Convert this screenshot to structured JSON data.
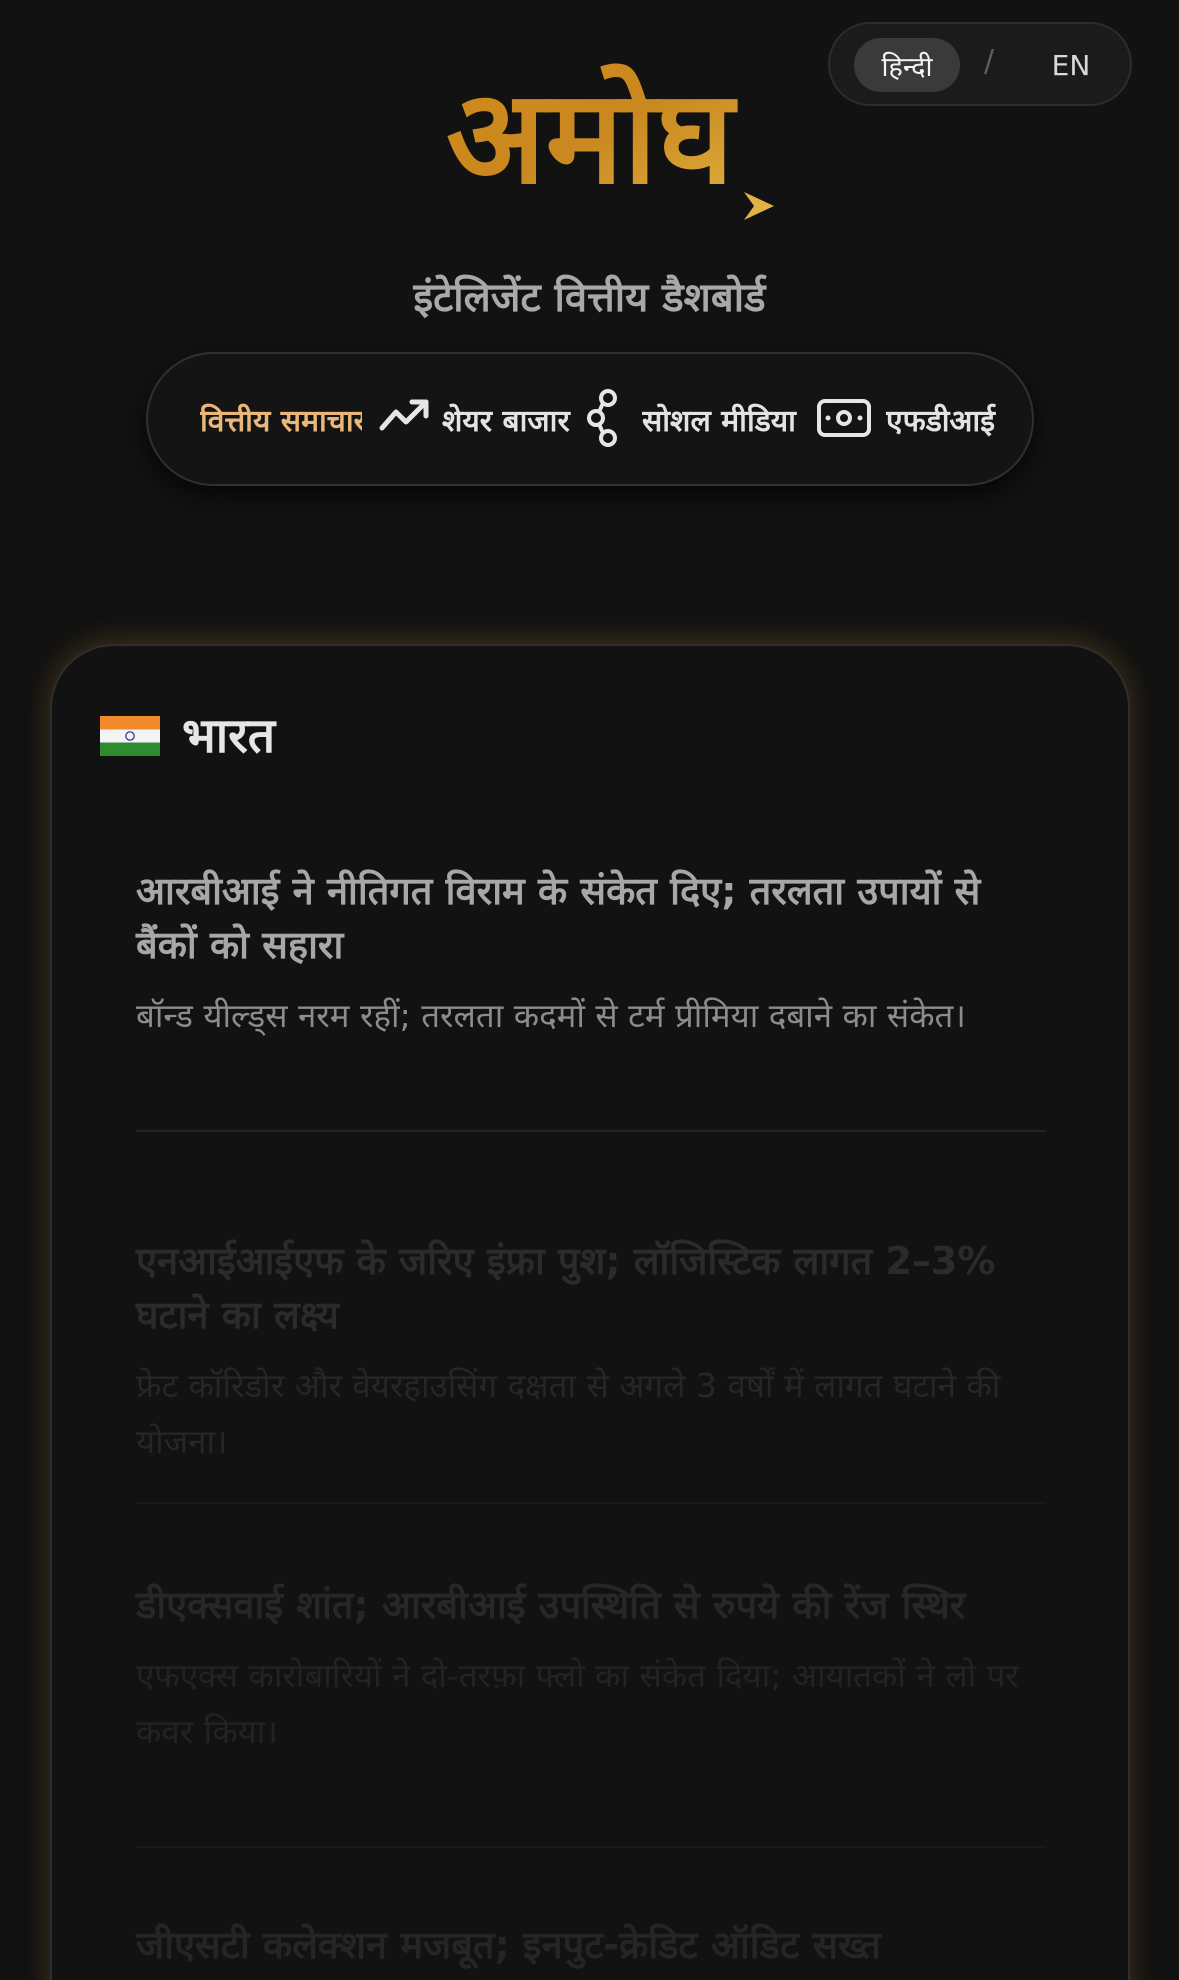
{
  "language_toggle": {
    "active": "हिन्दी",
    "separator": "/",
    "inactive": "EN"
  },
  "brand": {
    "logo_text": "अमोघ",
    "subtitle": "इंटेलिजेंट वित्तीय डैशबोर्ड",
    "colors": {
      "gold": "#c78a22",
      "gold_light": "#e2b245"
    }
  },
  "nav": {
    "items": [
      {
        "label": "वित्तीय समाचार",
        "icon": "none",
        "active": true
      },
      {
        "label": "शेयर बाजार",
        "icon": "trending-up-icon",
        "active": false
      },
      {
        "label": "सोशल मीडिया",
        "icon": "share-icon",
        "active": false
      },
      {
        "label": "एफडीआई",
        "icon": "money-icon",
        "active": false
      }
    ],
    "active_color": "#e9b77a"
  },
  "section": {
    "country": "भारत",
    "news": [
      {
        "title": "आरबीआई ने नीतिगत विराम के संकेत दिए; तरलता उपायों से बैंकों को सहारा",
        "summary": "बॉन्ड यील्ड्स नरम रहीं; तरलता कदमों से टर्म प्रीमिया दबाने का संकेत।"
      },
      {
        "title": "एनआईआईएफ के जरिए इंफ्रा पुश; लॉजिस्टिक लागत 2–3% घटाने का लक्ष्य",
        "summary": "फ्रेट कॉरिडोर और वेयरहाउसिंग दक्षता से अगले 3 वर्षों में लागत घटाने की योजना।"
      },
      {
        "title": "डीएक्सवाई शांत; आरबीआई उपस्थिति से रुपये की रेंज स्थिर",
        "summary": "एफएक्स कारोबारियों ने दो-तरफ़ा फ्लो का संकेत दिया; आयातकों ने लो पर कवर किया।"
      },
      {
        "title": "जीएसटी कलेक्शन मजबूत; इनपुट-क्रेडिट ऑडिट सख्त",
        "summary": ""
      }
    ]
  }
}
